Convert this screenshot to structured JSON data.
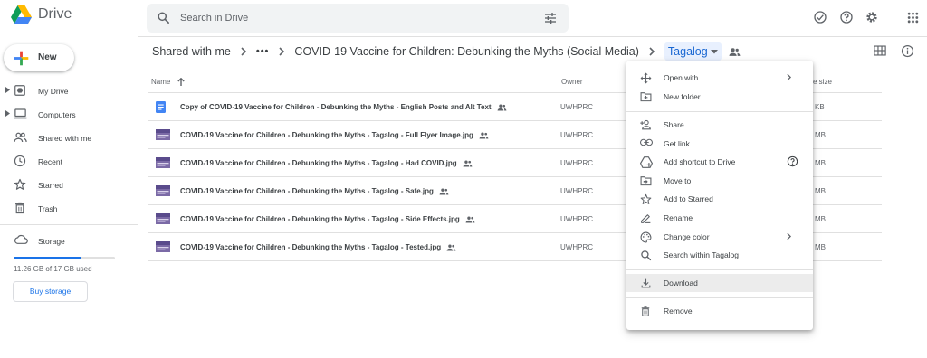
{
  "app": {
    "name": "Drive"
  },
  "search": {
    "placeholder": "Search in Drive"
  },
  "sidebar": {
    "new_label": "New",
    "items": [
      {
        "label": "My Drive"
      },
      {
        "label": "Computers"
      },
      {
        "label": "Shared with me"
      },
      {
        "label": "Recent"
      },
      {
        "label": "Starred"
      },
      {
        "label": "Trash"
      }
    ],
    "storage": {
      "label": "Storage",
      "used_text": "11.26 GB of 17 GB used",
      "used_fraction": 0.66,
      "buy_label": "Buy storage"
    }
  },
  "breadcrumb": {
    "root": "Shared with me",
    "ellipsis": "•••",
    "parent": "COVID-19 Vaccine for Children: Debunking the Myths (Social Media)",
    "current": "Tagalog"
  },
  "table": {
    "headers": {
      "name": "Name",
      "owner": "Owner",
      "size": "e size"
    },
    "rows": [
      {
        "name": "Copy of COVID-19 Vaccine for Children - Debunking the Myths - English Posts and Alt Text",
        "owner": "UWHPRC",
        "size": "KB",
        "type": "doc"
      },
      {
        "name": "COVID-19 Vaccine for Children - Debunking the Myths - Tagalog - Full Flyer Image.jpg",
        "owner": "UWHPRC",
        "size": "MB",
        "type": "image"
      },
      {
        "name": "COVID-19 Vaccine for Children - Debunking the Myths - Tagalog - Had COVID.jpg",
        "owner": "UWHPRC",
        "size": "MB",
        "type": "image"
      },
      {
        "name": "COVID-19 Vaccine for Children - Debunking the Myths - Tagalog - Safe.jpg",
        "owner": "UWHPRC",
        "size": "MB",
        "type": "image"
      },
      {
        "name": "COVID-19 Vaccine for Children - Debunking the Myths - Tagalog - Side Effects.jpg",
        "owner": "UWHPRC",
        "size": "MB",
        "type": "image"
      },
      {
        "name": "COVID-19 Vaccine for Children - Debunking the Myths - Tagalog - Tested.jpg",
        "owner": "UWHPRC",
        "size": "MB",
        "type": "image"
      }
    ]
  },
  "context_menu": {
    "items": [
      {
        "label": "Open with",
        "icon": "open-with-icon"
      },
      {
        "label": "New folder",
        "icon": "new-folder-icon"
      },
      {
        "label": "Share",
        "icon": "share-person-add-icon"
      },
      {
        "label": "Get link",
        "icon": "link-icon"
      },
      {
        "label": "Add shortcut to Drive",
        "icon": "add-shortcut-icon"
      },
      {
        "label": "Move to",
        "icon": "move-to-icon"
      },
      {
        "label": "Add to Starred",
        "icon": "star-icon"
      },
      {
        "label": "Rename",
        "icon": "pencil-icon"
      },
      {
        "label": "Change color",
        "icon": "palette-icon"
      },
      {
        "label": "Search within Tagalog",
        "icon": "search-icon"
      },
      {
        "label": "Download",
        "icon": "download-icon"
      },
      {
        "label": "Remove",
        "icon": "trash-icon"
      }
    ],
    "highlighted": "Download"
  },
  "colors": {
    "accent_blue": "#1a73e8",
    "current_crumb_bg": "#e8f0fe",
    "doc_icon": "#4285f4",
    "text": "#3c4043",
    "muted": "#5f6368"
  }
}
